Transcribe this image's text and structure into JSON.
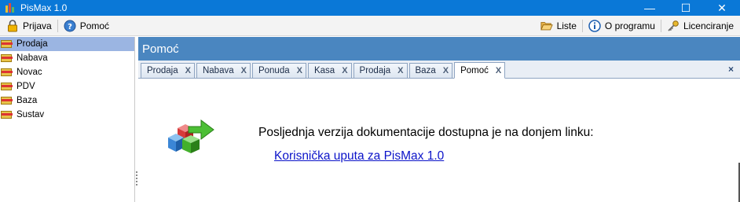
{
  "window": {
    "title": "PisMax 1.0",
    "controls": {
      "minimize": "—",
      "maximize": "☐",
      "close": "✕"
    }
  },
  "menubar": {
    "left": [
      {
        "label": "Prijava",
        "icon": "lock-icon"
      },
      {
        "label": "Pomoć",
        "icon": "help-icon"
      }
    ],
    "right": [
      {
        "label": "Liste",
        "icon": "folder-open-icon"
      },
      {
        "label": "O programu",
        "icon": "info-icon"
      },
      {
        "label": "Licenciranje",
        "icon": "key-icon"
      }
    ]
  },
  "sidebar": {
    "items": [
      {
        "label": "Prodaja",
        "selected": true
      },
      {
        "label": "Nabava",
        "selected": false
      },
      {
        "label": "Novac",
        "selected": false
      },
      {
        "label": "PDV",
        "selected": false
      },
      {
        "label": "Baza",
        "selected": false
      },
      {
        "label": "Sustav",
        "selected": false
      }
    ]
  },
  "panel": {
    "title": "Pomoć",
    "tabs": [
      {
        "label": "Prodaja",
        "active": false
      },
      {
        "label": "Nabava",
        "active": false
      },
      {
        "label": "Ponuda",
        "active": false
      },
      {
        "label": "Kasa",
        "active": false
      },
      {
        "label": "Prodaja",
        "active": false
      },
      {
        "label": "Baza",
        "active": false
      },
      {
        "label": "Pomoć",
        "active": true
      }
    ],
    "tab_close_glyph": "X",
    "strip_close_glyph": "×"
  },
  "content": {
    "message": "Posljednja verzija dokumentacije dostupna je na donjem linku:",
    "link_text": "Korisnička uputa za PisMax 1.0"
  },
  "colors": {
    "titlebar": "#0a78d7",
    "panel_header": "#4a86c0",
    "selection": "#9bb5e2",
    "link": "#0b13c9"
  }
}
